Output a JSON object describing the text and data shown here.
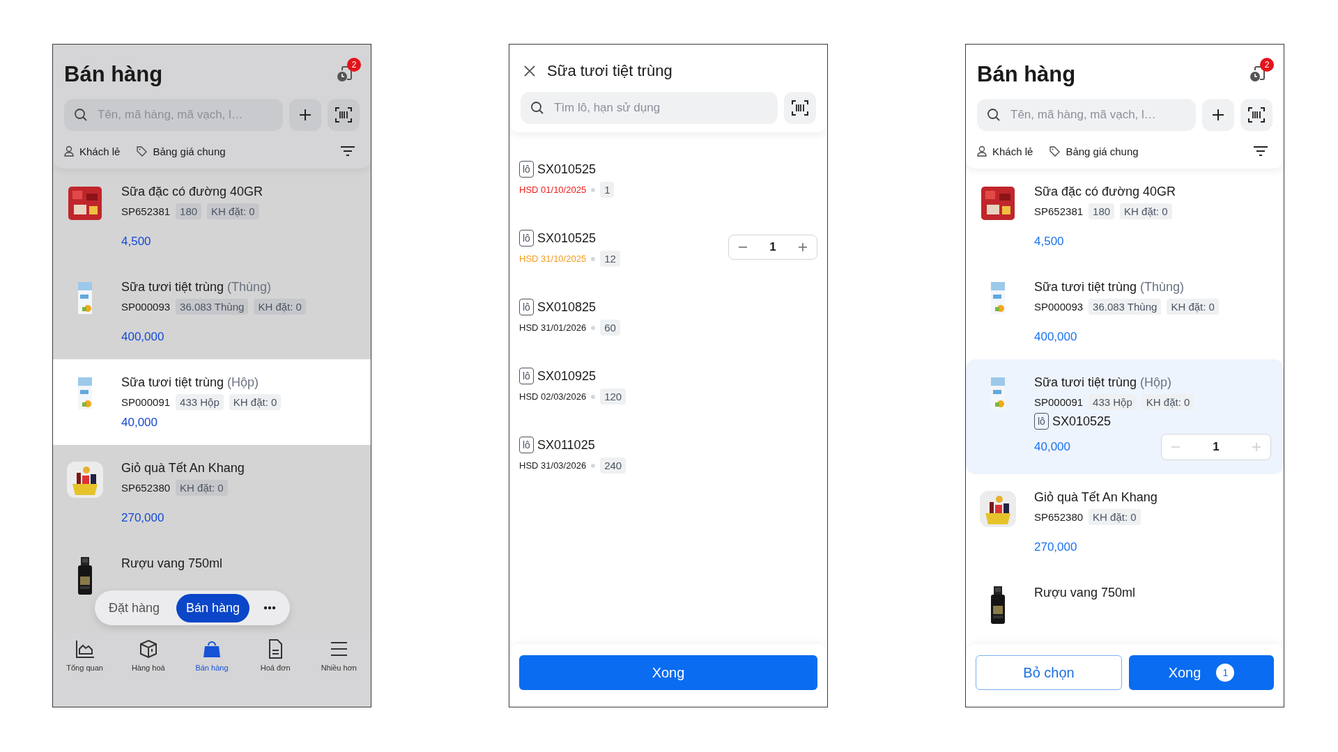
{
  "screens": [
    {
      "kind": "sale_list",
      "dimmed": true,
      "title": "Bán hàng",
      "notification_count": "2",
      "search": {
        "placeholder": "Tên, mã hàng, mã vạch, l…"
      },
      "customer": "Khách lẻ",
      "price_list": "Bảng giá chung",
      "products": [
        {
          "name": "Sữa đặc có đường 40GR",
          "code": "SP652381",
          "badges": [
            "180",
            "KH đặt: 0"
          ],
          "price": "4,500",
          "selected": false
        },
        {
          "name": "Sữa tươi tiệt trùng",
          "unit": "(Thùng)",
          "code": "SP000093",
          "badges": [
            "36.083 Thùng",
            "KH đặt: 0"
          ],
          "price": "400,000",
          "selected": false
        },
        {
          "name": "Sữa tươi tiệt trùng",
          "unit": "(Hộp)",
          "code": "SP000091",
          "badges": [
            "433 Hộp",
            "KH đặt: 0"
          ],
          "price": "40,000",
          "selected": true
        },
        {
          "name": "Giỏ quà Tết An Khang",
          "code": "SP652380",
          "badges": [
            "KH đặt: 0"
          ],
          "price": "270,000",
          "selected": false
        },
        {
          "name": "Rượu vang 750ml",
          "selected": false
        }
      ],
      "mode_switch": [
        {
          "label": "Đặt hàng",
          "selected": false
        },
        {
          "label": "Bán hàng",
          "selected": true
        }
      ],
      "tabs": [
        {
          "label": "Tổng quan",
          "selected": false
        },
        {
          "label": "Hàng hoá",
          "selected": false
        },
        {
          "label": "Bán hàng",
          "selected": true
        },
        {
          "label": "Hoá đơn",
          "selected": false
        },
        {
          "label": "Nhiều hơn",
          "selected": false
        }
      ]
    },
    {
      "kind": "lot_picker",
      "title": "Sữa tươi tiệt trùng",
      "search": {
        "placeholder": "Tìm lô, hạn sử dụng"
      },
      "lots": [
        {
          "tag": "lô",
          "code": "SX010525",
          "expiry": "HSD 01/10/2025",
          "color": "#ee1a1a",
          "stock": "1"
        },
        {
          "tag": "lô",
          "code": "SX010525",
          "expiry": "HSD 31/10/2025",
          "color": "#f59a1a",
          "stock": "12",
          "quantity": "1"
        },
        {
          "tag": "lô",
          "code": "SX010825",
          "expiry": "HSD 31/01/2026",
          "color": "#1a1a1a",
          "stock": "60"
        },
        {
          "tag": "lô",
          "code": "SX010925",
          "expiry": "HSD 02/03/2026",
          "color": "#1a1a1a",
          "stock": "120"
        },
        {
          "tag": "lô",
          "code": "SX011025",
          "expiry": "HSD 31/03/2026",
          "color": "#1a1a1a",
          "stock": "240"
        }
      ],
      "done_button": "Xong"
    },
    {
      "kind": "sale_list",
      "dimmed": false,
      "title": "Bán hàng",
      "notification_count": "2",
      "search": {
        "placeholder": "Tên, mã hàng, mã vạch, l…"
      },
      "customer": "Khách lẻ",
      "price_list": "Bảng giá chung",
      "products": [
        {
          "name": "Sữa đặc có đường 40GR",
          "code": "SP652381",
          "badges": [
            "180",
            "KH đặt: 0"
          ],
          "price": "4,500",
          "selected": false
        },
        {
          "name": "Sữa tươi tiệt trùng",
          "unit": "(Thùng)",
          "code": "SP000093",
          "badges": [
            "36.083 Thùng",
            "KH đặt: 0"
          ],
          "price": "400,000",
          "selected": false
        },
        {
          "name": "Sữa tươi tiệt trùng",
          "unit": "(Hộp)",
          "code": "SP000091",
          "badges": [
            "433 Hộp",
            "KH đặt: 0"
          ],
          "lot": {
            "tag": "lô",
            "code": "SX010525"
          },
          "price": "40,000",
          "quantity": "1",
          "selected": true
        },
        {
          "name": "Giỏ quà Tết An Khang",
          "code": "SP652380",
          "badges": [
            "KH đặt: 0"
          ],
          "price": "270,000",
          "selected": false
        },
        {
          "name": "Rượu vang 750ml",
          "selected": false
        }
      ],
      "footer": {
        "clear_button": "Bỏ chọn",
        "done_button": "Xong",
        "done_count": "1"
      }
    }
  ]
}
